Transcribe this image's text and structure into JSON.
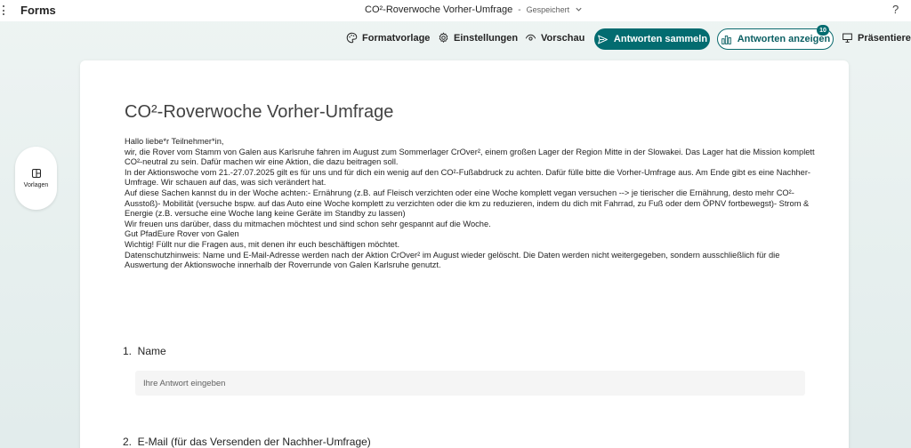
{
  "app": {
    "name": "Forms"
  },
  "document": {
    "title": "CO²-Roverwoche Vorher-Umfrage",
    "separator": "-",
    "status": "Gespeichert"
  },
  "help": {
    "label": "?"
  },
  "toolbar": {
    "format_label": "Formatvorlage",
    "settings_label": "Einstellungen",
    "preview_label": "Vorschau",
    "collect_label": "Antworten sammeln",
    "show_label": "Antworten anzeigen",
    "response_count": "10",
    "present_label": "Präsentieren"
  },
  "rail": {
    "templates_label": "Vorlagen"
  },
  "form": {
    "title": "CO²-Roverwoche Vorher-Umfrage",
    "description": [
      "Hallo liebe*r Teilnehmer*in,",
      "wir, die Rover vom Stamm von Galen aus Karlsruhe fahren im August zum Sommerlager CrOver², einem großen Lager der Region Mitte in der Slowakei. Das Lager hat die Mission komplett CO²-neutral zu sein. Dafür machen wir eine Aktion, die dazu beitragen soll.",
      "In der Aktionswoche vom 21.-27.07.2025 gilt es für uns und für dich ein wenig auf den CO²-Fußabdruck zu achten. Dafür fülle bitte die Vorher-Umfrage aus. Am Ende gibt es eine Nachher-Umfrage. Wir schauen auf das, was sich verändert hat.",
      "Auf diese Sachen kannst du in der Woche achten:- Ernährung (z.B. auf Fleisch verzichten oder eine Woche komplett vegan versuchen --> je tierischer die Ernährung, desto mehr CO²-Ausstoß)- Mobilität (versuche bspw. auf das Auto eine Woche komplett zu verzichten oder die km zu reduzieren, indem du dich mit Fahrrad, zu Fuß oder dem ÖPNV fortbewegst)- Strom & Energie (z.B. versuche eine Woche lang keine Geräte im Standby zu lassen)",
      "Wir freuen uns darüber, dass du mitmachen möchtest und sind schon sehr gespannt auf die Woche.",
      "Gut PfadEure Rover von Galen",
      "Wichtig! Füllt nur die Fragen aus, mit denen ihr euch beschäftigen möchtet.",
      "Datenschutzhinweis: Name und E-Mail-Adresse werden nach der Aktion CrOver² im August wieder gelöscht. Die Daten werden nicht weitergegeben, sondern ausschließlich für die Auswertung der Aktionswoche innerhalb der Roverrunde von Galen Karlsruhe genutzt."
    ],
    "questions": [
      {
        "label": "1.  Name",
        "placeholder": "Ihre Antwort eingeben"
      },
      {
        "label": "2.  E-Mail (für das Versenden der Nachher-Umfrage)"
      }
    ]
  },
  "colors": {
    "accent": "#036c70",
    "background": "#e6efee"
  }
}
